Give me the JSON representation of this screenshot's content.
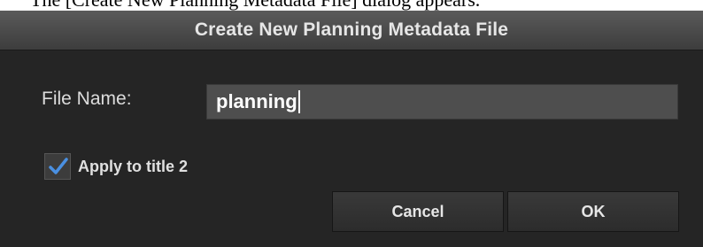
{
  "document": {
    "partial_text": "The [Create New Planning Metadata File] dialog appears."
  },
  "dialog": {
    "title": "Create New Planning Metadata File",
    "file_name_label": "File Name:",
    "file_name_value": "planning",
    "apply_checkbox": {
      "label": "Apply to title 2",
      "checked": true
    },
    "cancel_label": "Cancel",
    "ok_label": "OK"
  },
  "colors": {
    "dialog_bg": "#252525",
    "title_bar": "#4a4a4a",
    "input_bg": "#4e4e4e",
    "checkmark": "#4a90e2"
  }
}
